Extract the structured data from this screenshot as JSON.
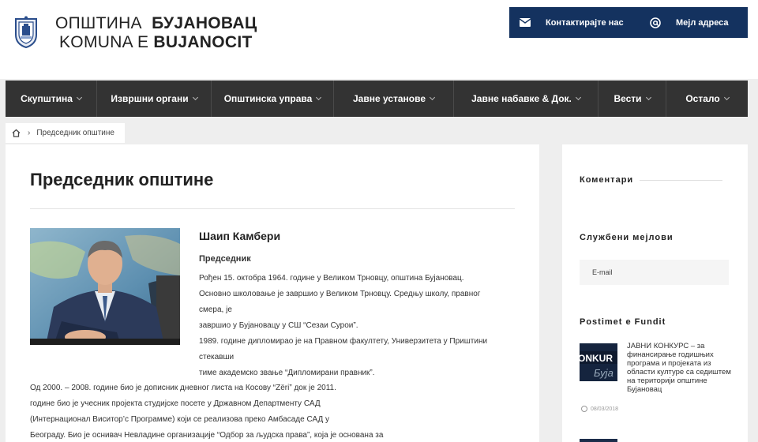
{
  "header": {
    "title_line1_plain": "ОПШТИНА",
    "title_line1_bold": "БУЈАНОВАЦ",
    "title_line2_plain": "KOMUNA E",
    "title_line2_bold": "BUJANOCIT",
    "contact_label": "Контактирајте нас",
    "email_label": "Мејл адреса",
    "contact_icon": "envelope-icon",
    "email_icon": "at-icon",
    "accent_color": "#14325f"
  },
  "nav": {
    "items": [
      {
        "label": "Скупштина"
      },
      {
        "label": "Извршни органи"
      },
      {
        "label": "Општинска управа"
      },
      {
        "label": "Јавне установе"
      },
      {
        "label": "Јавне набавке & Док."
      },
      {
        "label": "Вести"
      },
      {
        "label": "Остало"
      }
    ],
    "bg_color": "#333333"
  },
  "breadcrumb": {
    "home_icon": "home-icon",
    "current": "Председник општине"
  },
  "main": {
    "title": "Председник општине",
    "name": "Шаип Камбери",
    "role": "Председник",
    "bio_top": [
      "Рођен 15. октобра 1964. године у Великом Трновцу, општина Бујановац.",
      "Основно школовање је завршио у Великом Трновцу. Средњу школу, правног",
      "смера, је",
      "завршио у Бујановацу у СШ “Сезаи Сурои”.",
      "1989. године дипломирао је на Правном факултету, Универзитета у Приштини",
      "стекавши",
      "тиме академско звање “Дипломирани правник”."
    ],
    "bio_bottom": [
      "Од 2000. – 2008. године био је дописник дневног листа на Косову “Zëri” док је 2011.",
      "године био је учесник пројекта студијске посете у Државном Департменту САД",
      "(Интернационал Виситор’с Программе) који се реализова преко Амбасаде САД у",
      "Београду. Био је оснивач Невладине организације “Одбор за људска права”, која је основана за"
    ]
  },
  "sidebar": {
    "comments_heading": "Коментари",
    "emails_heading": "Службени мејлови",
    "email_placeholder": "E-mail",
    "recent_heading": "Postimet e Fundit",
    "post": {
      "title": "ЈАВНИ КОНКУРС – за финансирање годишњих програма и пројеката из области културе са седиштем на територији општине Бујановац",
      "thumb_text": "ONKUR",
      "thumb_text2": "Буја",
      "date": "08/03/2018"
    }
  }
}
